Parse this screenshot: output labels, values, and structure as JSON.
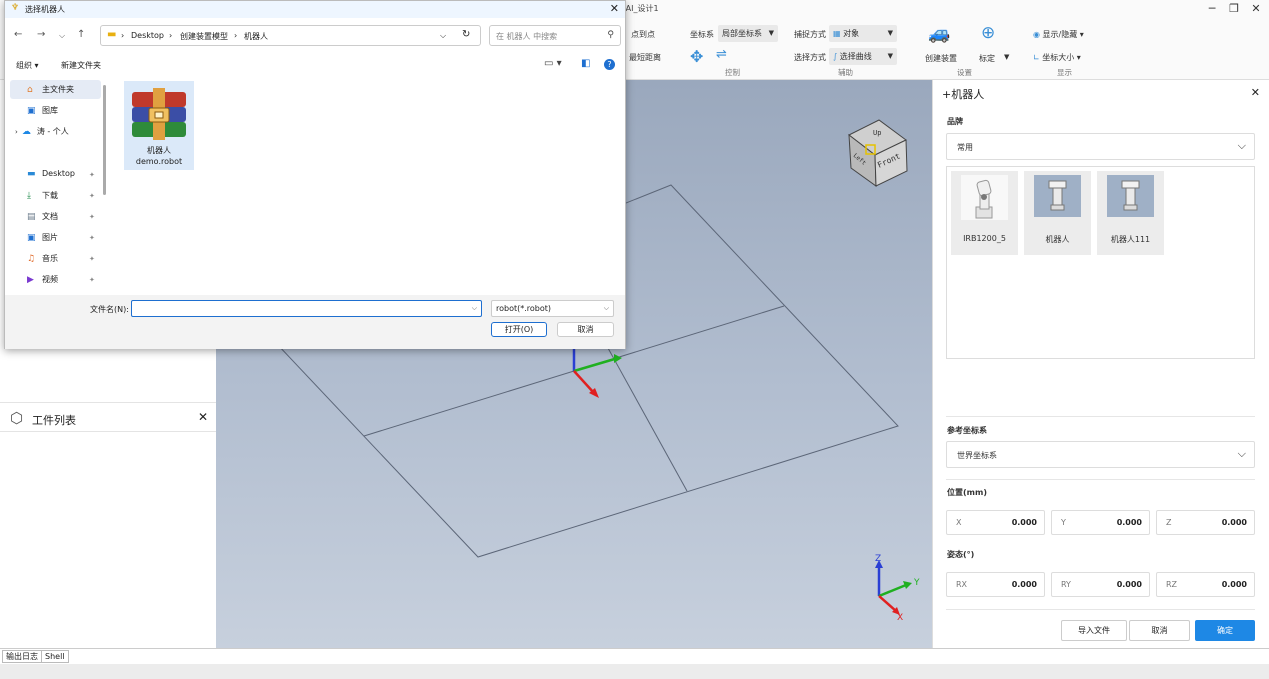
{
  "app": {
    "title": "RobAI_设计1",
    "minimize": "─",
    "maximize": "❐",
    "close": "✕"
  },
  "ribbon": {
    "point_to_point": "点到点",
    "min_distance": "最短距离",
    "coord_label": "坐标系",
    "coord_value": "局部坐标系",
    "control_group": "控制",
    "snap_label": "捕捉方式",
    "snap_value": "对象",
    "select_label": "选择方式",
    "select_value": "选择曲线",
    "aux_group": "辅助",
    "create_device": "创建装置",
    "calibrate": "标定",
    "settings_group": "设置",
    "show_hide": "显示/隐藏",
    "axis_size": "坐标大小",
    "display_group": "显示"
  },
  "dialog": {
    "title": "选择机器人",
    "breadcrumbs": [
      "Desktop",
      "创建装置模型",
      "机器人"
    ],
    "search_placeholder": "在 机器人 中搜索",
    "organize": "组织",
    "new_folder": "新建文件夹",
    "nav_items": [
      {
        "label": "主文件夹",
        "icon": "home-icon"
      },
      {
        "label": "图库",
        "icon": "gallery-icon"
      },
      {
        "label": "涛 - 个人",
        "icon": "cloud-icon"
      },
      {
        "label": "Desktop",
        "icon": "desktop-icon"
      },
      {
        "label": "下载",
        "icon": "download-icon"
      },
      {
        "label": "文档",
        "icon": "document-icon"
      },
      {
        "label": "图片",
        "icon": "pictures-icon"
      },
      {
        "label": "音乐",
        "icon": "music-icon"
      },
      {
        "label": "视频",
        "icon": "video-icon"
      }
    ],
    "file": {
      "name_line1": "机器人",
      "name_line2": "demo.robot"
    },
    "filename_label": "文件名(N):",
    "filename_value": "",
    "filetype": "robot(*.robot)",
    "open_btn": "打开(O)",
    "cancel_btn": "取消"
  },
  "left": {
    "worklist_title": "工件列表",
    "close": "✕"
  },
  "viewport": {
    "cube_top": "Up",
    "cube_front": "Front",
    "cube_left": "Left",
    "axis_z": "Z",
    "axis_y": "Y",
    "axis_x": "X"
  },
  "panel": {
    "title": "+机器人",
    "close": "✕",
    "brand_label": "品牌",
    "brand_value": "常用",
    "robots": [
      "IRB1200_5",
      "机器人",
      "机器人111"
    ],
    "ref_frame_label": "参考坐标系",
    "ref_frame_value": "世界坐标系",
    "position_label": "位置(mm)",
    "position": [
      {
        "axis": "X",
        "value": "0.000"
      },
      {
        "axis": "Y",
        "value": "0.000"
      },
      {
        "axis": "Z",
        "value": "0.000"
      }
    ],
    "orientation_label": "姿态(°)",
    "orientation": [
      {
        "axis": "RX",
        "value": "0.000"
      },
      {
        "axis": "RY",
        "value": "0.000"
      },
      {
        "axis": "RZ",
        "value": "0.000"
      }
    ],
    "import_btn": "导入文件",
    "cancel_btn": "取消",
    "ok_btn": "确定"
  },
  "bottom": {
    "tabs": [
      "输出日志",
      "Shell"
    ]
  }
}
